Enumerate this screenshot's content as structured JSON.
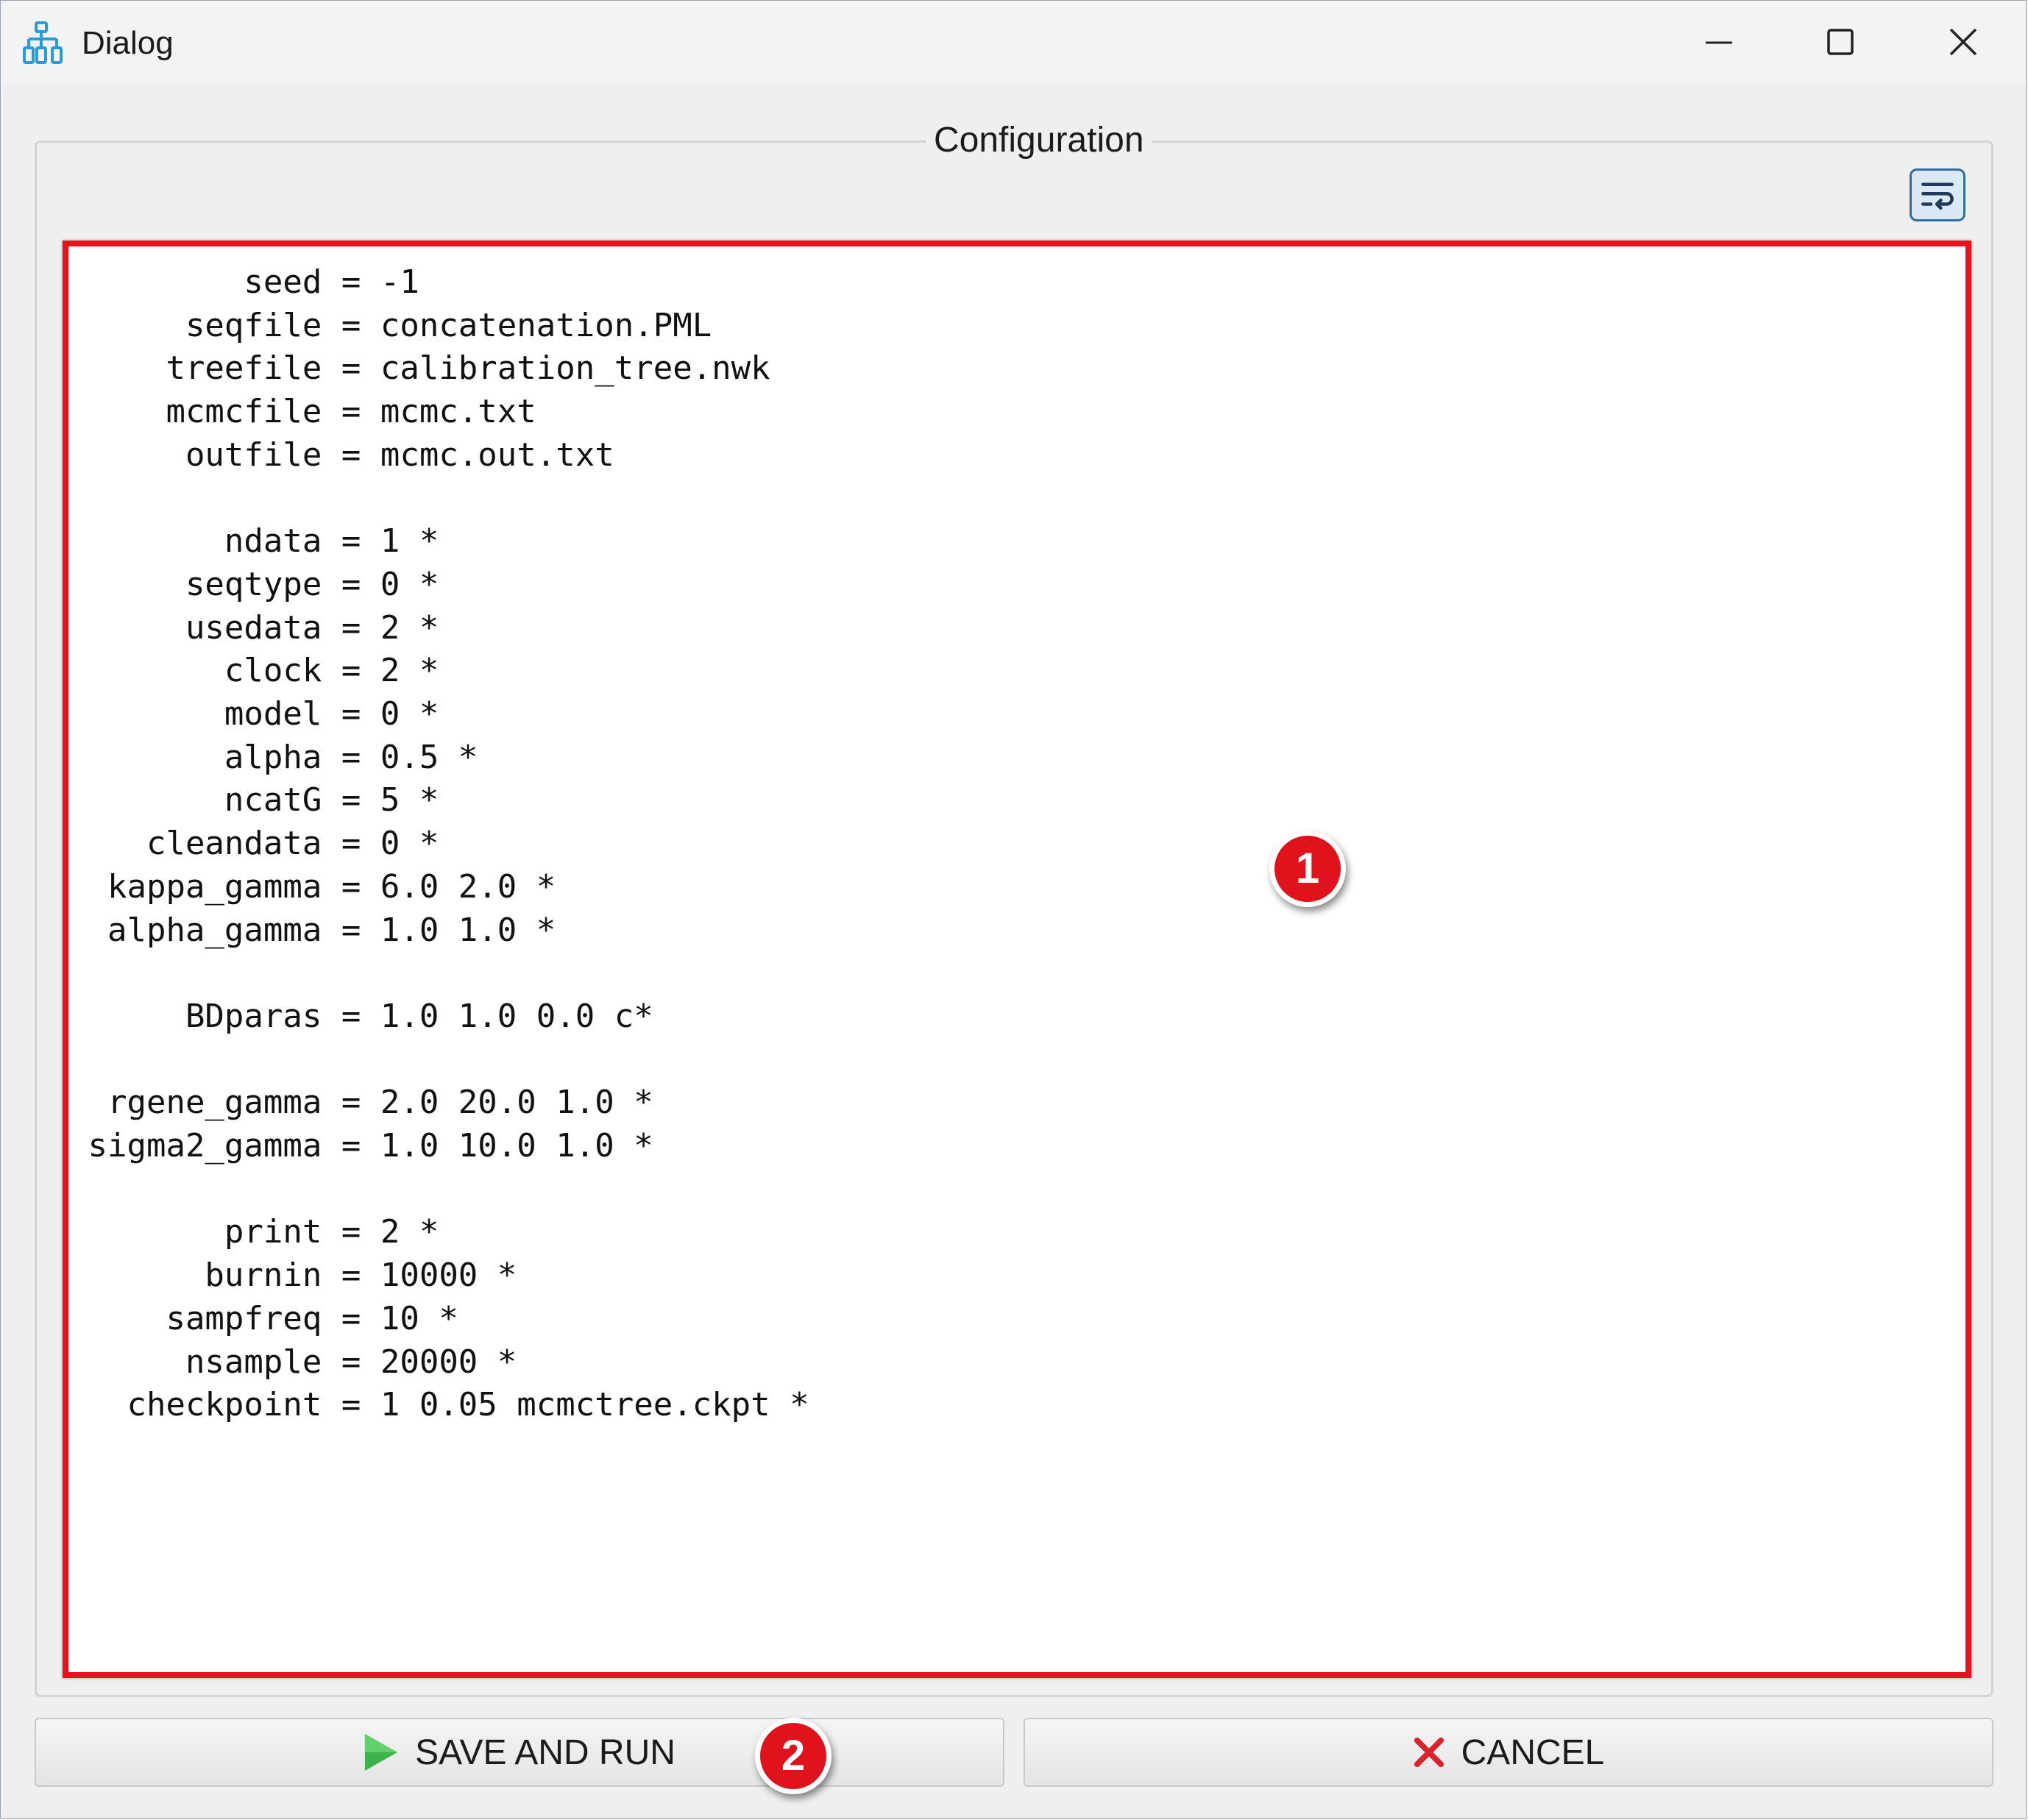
{
  "window": {
    "title": "Dialog"
  },
  "config_group": {
    "title": "Configuration",
    "wrap_icon": "word-wrap-icon"
  },
  "editor": {
    "text": "         seed = -1\n      seqfile = concatenation.PML\n     treefile = calibration_tree.nwk\n     mcmcfile = mcmc.txt\n      outfile = mcmc.out.txt\n\n        ndata = 1 *\n      seqtype = 0 *\n      usedata = 2 *\n        clock = 2 *\n        model = 0 *\n        alpha = 0.5 *\n        ncatG = 5 *\n    cleandata = 0 *\n  kappa_gamma = 6.0 2.0 *\n  alpha_gamma = 1.0 1.0 *\n\n      BDparas = 1.0 1.0 0.0 c*\n\n  rgene_gamma = 2.0 20.0 1.0 *\n sigma2_gamma = 1.0 10.0 1.0 *\n\n        print = 2 *\n       burnin = 10000 *\n     sampfreq = 10 *\n      nsample = 20000 *\n   checkpoint = 1 0.05 mcmctree.ckpt *"
  },
  "annotations": {
    "badge_1": "1",
    "badge_2": "2",
    "highlight_color": "#e8101a"
  },
  "buttons": {
    "save_run_label": "SAVE AND RUN",
    "save_run_icon": "play-icon",
    "cancel_label": "CANCEL",
    "cancel_icon": "close-x-icon",
    "play_color": "#3cb44b",
    "cancel_color": "#d9242b"
  }
}
